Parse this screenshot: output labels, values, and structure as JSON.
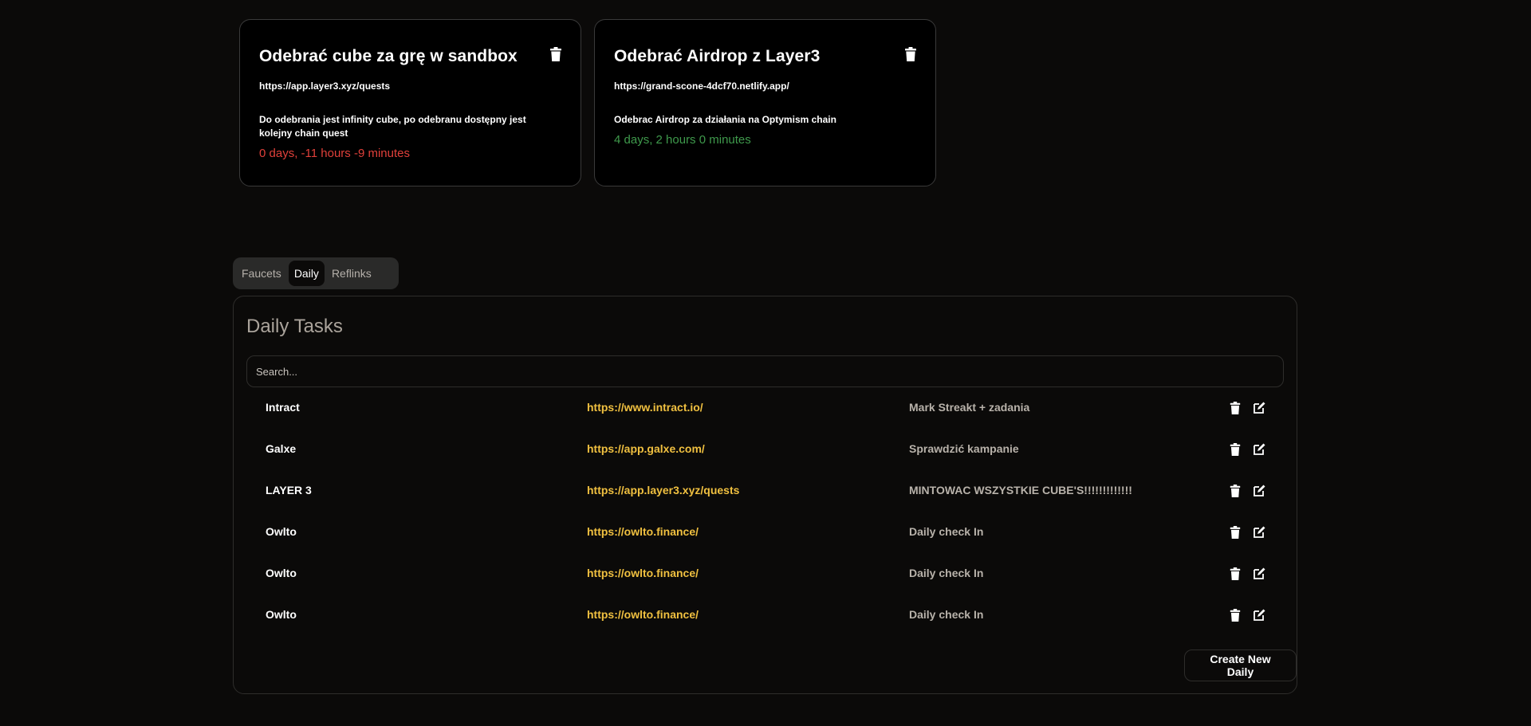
{
  "cards": [
    {
      "title": "Odebrać cube za grę w sandbox",
      "url": "https://app.layer3.xyz/quests",
      "description": "Do odebrania jest infinity cube, po odebranu dostępny jest kolejny chain quest",
      "time": "0 days, -11 hours -9 minutes",
      "time_status": "overdue"
    },
    {
      "title": "Odebrać Airdrop z Layer3",
      "url": "https://grand-scone-4dcf70.netlify.app/",
      "description": "Odebrac Airdrop za działania na Optymism chain",
      "time": "4 days, 2 hours 0 minutes",
      "time_status": "upcoming"
    }
  ],
  "tabs": [
    {
      "label": "Faucets",
      "active": false
    },
    {
      "label": "Daily",
      "active": true
    },
    {
      "label": "Reflinks",
      "active": false
    }
  ],
  "daily": {
    "title": "Daily Tasks",
    "search_placeholder": "Search...",
    "rows": [
      {
        "name": "Intract",
        "url": "https://www.intract.io/",
        "note": "Mark Streakt + zadania"
      },
      {
        "name": "Galxe",
        "url": "https://app.galxe.com/",
        "note": "Sprawdzić kampanie"
      },
      {
        "name": "LAYER 3",
        "url": "https://app.layer3.xyz/quests",
        "note": "MINTOWAC WSZYSTKIE CUBE'S!!!!!!!!!!!!!"
      },
      {
        "name": "Owlto",
        "url": "https://owlto.finance/",
        "note": "Daily check In"
      },
      {
        "name": "Owlto",
        "url": "https://owlto.finance/",
        "note": "Daily check In"
      },
      {
        "name": "Owlto",
        "url": "https://owlto.finance/",
        "note": "Daily check In"
      }
    ],
    "create_label": "Create New Daily"
  },
  "colors": {
    "background": "#0b0a09",
    "overdue": "#e0403a",
    "upcoming": "#3f9a4c",
    "link": "#f0c040"
  },
  "icons": {
    "delete": "trash-icon",
    "edit": "edit-icon"
  }
}
